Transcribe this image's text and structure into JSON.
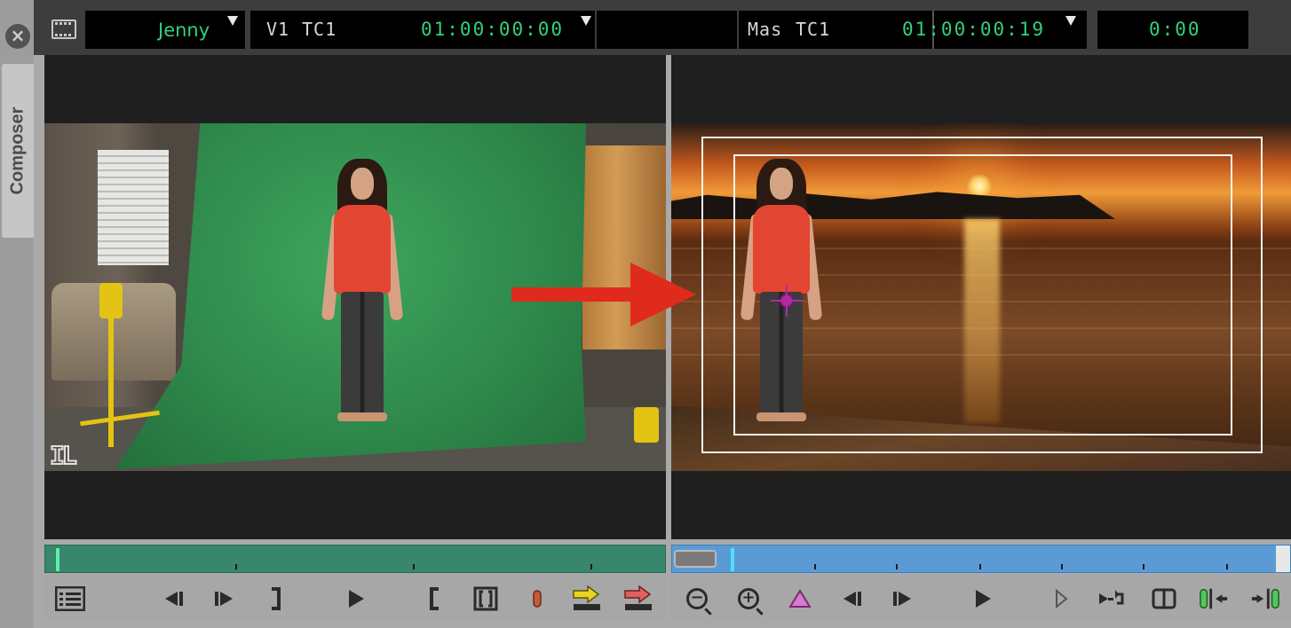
{
  "sidebar": {
    "close_label": "×",
    "tab_label": "Composer"
  },
  "topbar": {
    "clip_name": "Jenny",
    "source_track": "V1",
    "source_tc_label": "TC1",
    "source_timecode": "01:00:00:00",
    "record_track": "Mas",
    "record_tc_label": "TC1",
    "record_timecode": "01:00:00:19",
    "duration": "0:00"
  },
  "source_monitor": {
    "logo_text": "IL"
  },
  "colors": {
    "accent_green": "#33d07a",
    "source_timeline": "#38866c",
    "record_timeline": "#5b9bd5",
    "arrow": "#e02a1c",
    "crosshair": "#b02ba0"
  },
  "source_controls": [
    {
      "name": "clip-list-icon"
    },
    {
      "name": "step-back-icon"
    },
    {
      "name": "step-forward-icon"
    },
    {
      "name": "mark-out-icon"
    },
    {
      "name": "play-icon"
    },
    {
      "name": "mark-in-icon"
    },
    {
      "name": "mark-clip-icon"
    },
    {
      "name": "clear-marks-icon"
    },
    {
      "name": "splice-in-icon"
    },
    {
      "name": "overwrite-icon"
    }
  ],
  "record_controls": [
    {
      "name": "zoom-out-icon"
    },
    {
      "name": "zoom-in-icon"
    },
    {
      "name": "add-marker-icon"
    },
    {
      "name": "step-back-icon"
    },
    {
      "name": "step-forward-icon"
    },
    {
      "name": "play-icon"
    },
    {
      "name": "play-reverse-icon"
    },
    {
      "name": "loop-icon"
    },
    {
      "name": "split-view-icon"
    },
    {
      "name": "trim-in-icon"
    },
    {
      "name": "trim-out-icon"
    }
  ]
}
